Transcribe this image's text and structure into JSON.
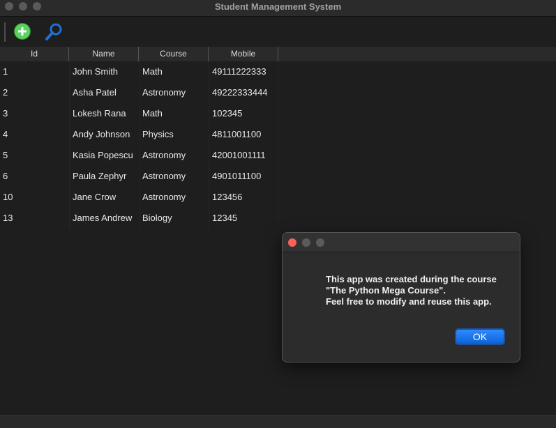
{
  "window": {
    "title": "Student Management System"
  },
  "toolbar": {
    "add_icon": "add-icon",
    "search_icon": "search-icon"
  },
  "table": {
    "columns": [
      "Id",
      "Name",
      "Course",
      "Mobile"
    ],
    "rows": [
      [
        "1",
        "John Smith",
        "Math",
        "49111222333"
      ],
      [
        "2",
        "Asha Patel",
        "Astronomy",
        "49222333444"
      ],
      [
        "3",
        "Lokesh Rana",
        "Math",
        "102345"
      ],
      [
        "4",
        "Andy Johnson",
        "Physics",
        "4811001100"
      ],
      [
        "5",
        "Kasia Popescu",
        "Astronomy",
        "42001001111"
      ],
      [
        "6",
        "Paula Zephyr",
        "Astronomy",
        "4901011100"
      ],
      [
        "10",
        "Jane Crow",
        "Astronomy",
        "123456"
      ],
      [
        "13",
        "James Andrew",
        "Biology",
        "12345"
      ]
    ]
  },
  "dialog": {
    "lines": [
      "This app was created during the course",
      "\"The Python Mega Course\".",
      "Feel free to modify and reuse this app."
    ],
    "ok_label": "OK"
  },
  "colors": {
    "close_red": "#fe5f57",
    "accent_blue": "#0a64d8",
    "add_green": "#5ad160"
  }
}
